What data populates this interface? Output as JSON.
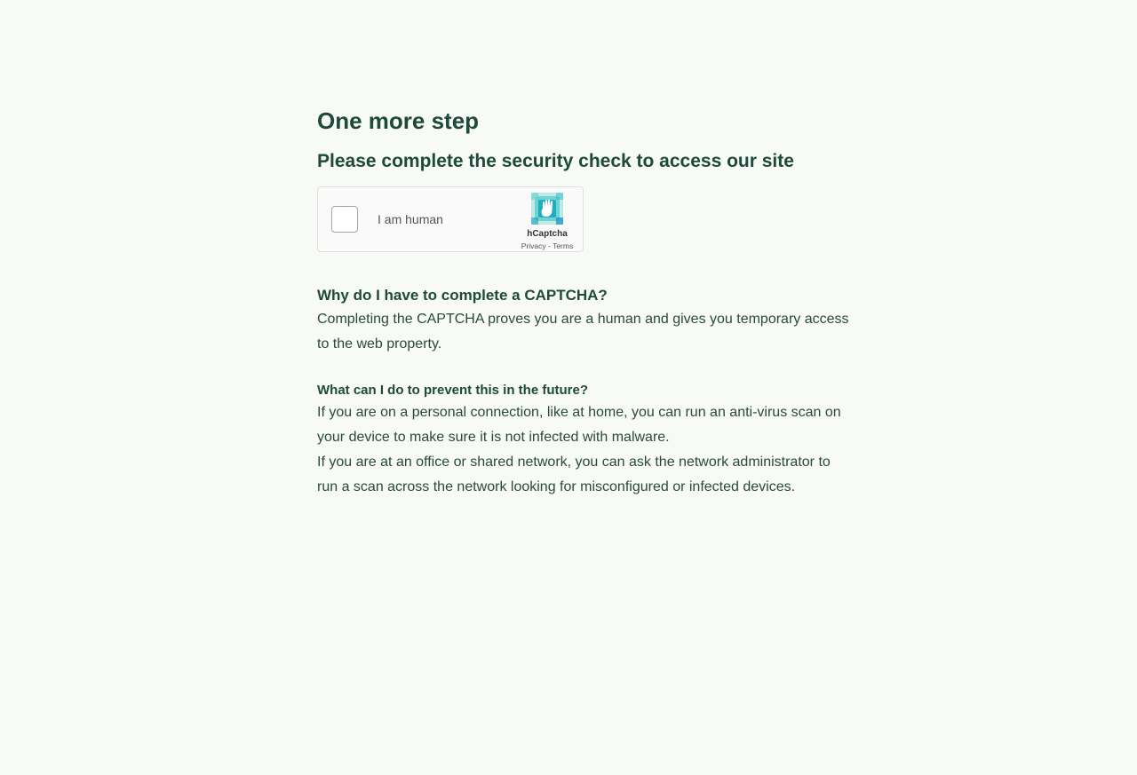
{
  "page": {
    "title": "One more step",
    "subtitle": "Please complete the security check to access our site"
  },
  "captcha": {
    "checkbox_label": "I am human",
    "brand": "hCaptcha",
    "privacy_link": "Privacy",
    "separator": " - ",
    "terms_link": "Terms",
    "logo_icon": "hcaptcha-hand-logo-icon"
  },
  "faq": {
    "why_heading": "Why do I have to complete a CAPTCHA?",
    "why_text": "Completing the CAPTCHA proves you are a human and gives you temporary access to the web property.",
    "prevent_heading": "What can I do to prevent this in the future?",
    "prevent_text_personal": "If you are on a personal connection, like at home, you can run an anti-virus scan on your device to make sure it is not infected with malware.",
    "prevent_text_office": "If you are at an office or shared network, you can ask the network administrator to run a scan across the network looking for misconfigured or infected devices."
  },
  "colors": {
    "background": "#f7faf5",
    "heading": "#1d4a3c",
    "text": "#2a4a40"
  }
}
